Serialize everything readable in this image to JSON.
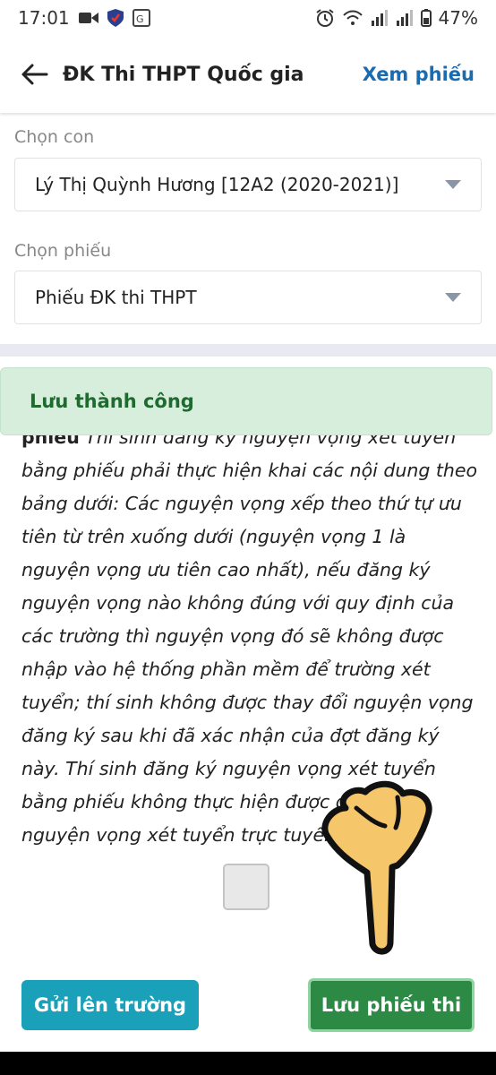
{
  "status_bar": {
    "time": "17:01",
    "battery": "47%",
    "icons_left": [
      "video-icon",
      "shield-icon",
      "translate-icon"
    ],
    "icons_right": [
      "alarm-icon",
      "wifi-icon",
      "signal-icon",
      "signal-icon",
      "battery-icon"
    ]
  },
  "app_bar": {
    "title": "ĐK Thi THPT Quốc gia",
    "action": "Xem phiếu"
  },
  "form": {
    "child_label": "Chọn con",
    "child_value": "Lý Thị Quỳnh Hương [12A2 (2020-2021)]",
    "form_label": "Chọn phiếu",
    "form_value": "Phiếu ĐK thi THPT"
  },
  "toast": {
    "message": "Lưu thành công"
  },
  "instructions": {
    "lead": "phiếu",
    "text": "Thí sinh đăng ký nguyện vọng xét tuyển bằng phiếu phải thực hiện khai các nội dung theo bảng dưới: Các nguyện vọng xếp theo thứ tự ưu tiên từ trên xuống dưới (nguyện vọng 1 là nguyện vọng ưu tiên cao nhất), nếu đăng ký nguyện vọng nào không đúng với quy định của các trường thì nguyện vọng đó sẽ không được nhập vào hệ thống phần mềm để trường xét tuyển; thí sinh không được thay đổi nguyện vọng đăng ký sau khi đã xác nhận của đợt đăng ký này. Thí sinh đăng ký nguyện vọng xét tuyển bằng phiếu không thực hiện được đăng ký nguyện vọng xét tuyển trực tuyến"
  },
  "checkbox": {
    "checked": false
  },
  "buttons": {
    "send": "Gửi lên trường",
    "save": "Lưu phiếu thi"
  },
  "colors": {
    "accent": "#1a6bb0",
    "send_button": "#1aa0b8",
    "save_button": "#2c8a45",
    "toast_bg": "#d7eedd",
    "toast_text": "#1f6a2f"
  }
}
